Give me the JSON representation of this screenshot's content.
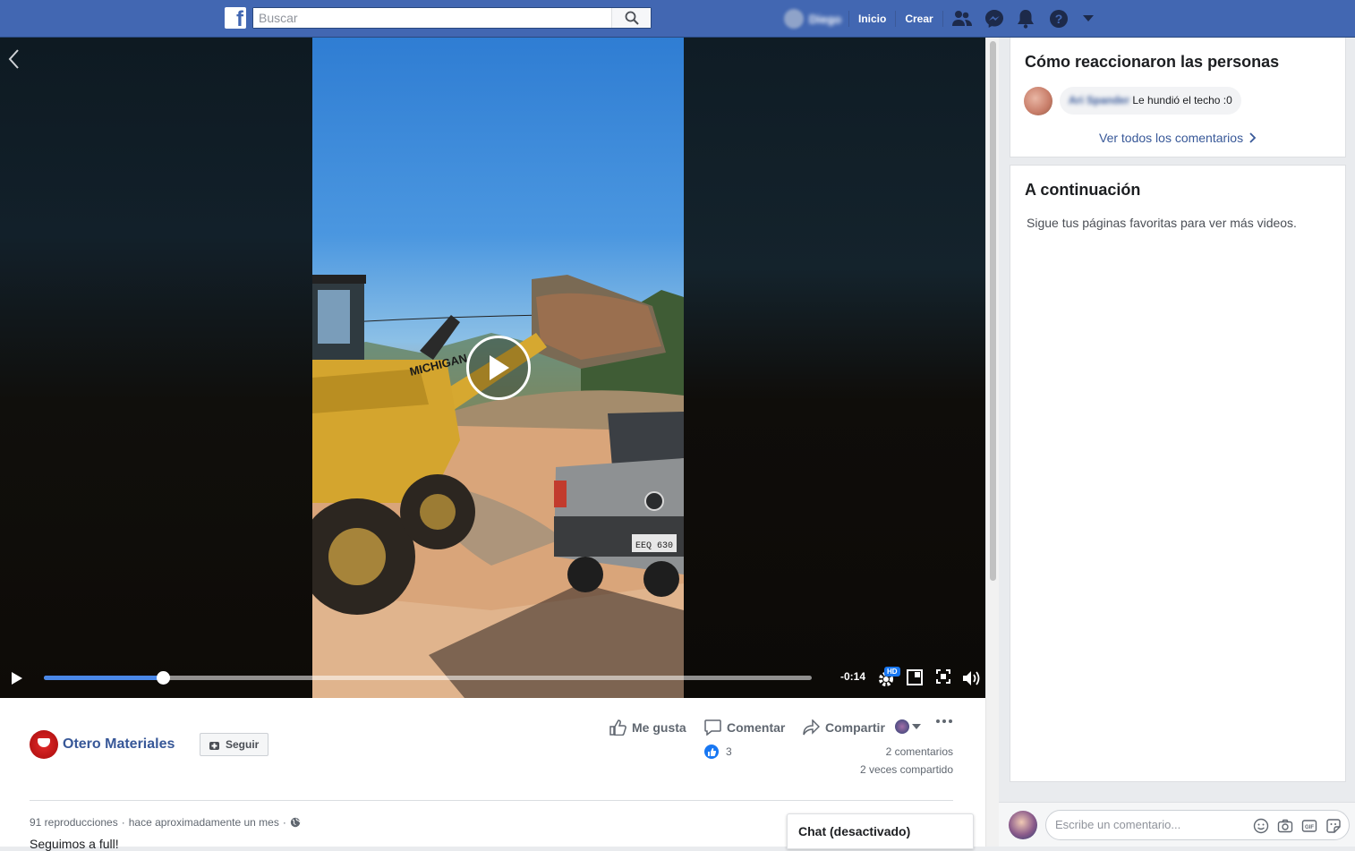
{
  "topbar": {
    "logo": "f",
    "search_placeholder": "Buscar",
    "user_name": "Diego",
    "nav_home": "Inicio",
    "nav_create": "Crear",
    "icons": [
      "friends-icon",
      "messenger-icon",
      "notifications-icon",
      "help-icon",
      "account-menu-icon"
    ]
  },
  "video": {
    "time_remaining": "-0:14",
    "progress": 0.155,
    "hd_badge": "HD",
    "loader_text": "MICHIGAN",
    "plate_text": "EEQ 630",
    "colors": {
      "progress": "#4a88e8",
      "topbar": "#4267b2"
    }
  },
  "post": {
    "page_name": "Otero Materiales",
    "follow_label": "Seguir",
    "like_label": "Me gusta",
    "comment_label": "Comentar",
    "share_label": "Compartir",
    "reactions_count": "3",
    "comments_count": "2 comentarios",
    "shares_count": "2 veces compartido",
    "views": "91 reproducciones",
    "time_ago": "hace aproximadamente un mes",
    "separator": "·",
    "description": "Seguimos a full!"
  },
  "chat": {
    "label": "Chat (desactivado)"
  },
  "sidebar": {
    "reactions_title": "Cómo reaccionaron las personas",
    "comment_author": "Ari Spander",
    "comment_text": "Le hundió el techo :0",
    "see_all": "Ver todos los comentarios",
    "next_title": "A continuación",
    "next_tip": "Sigue tus páginas favoritas para ver más videos.",
    "composer_placeholder": "Escribe un comentario..."
  }
}
